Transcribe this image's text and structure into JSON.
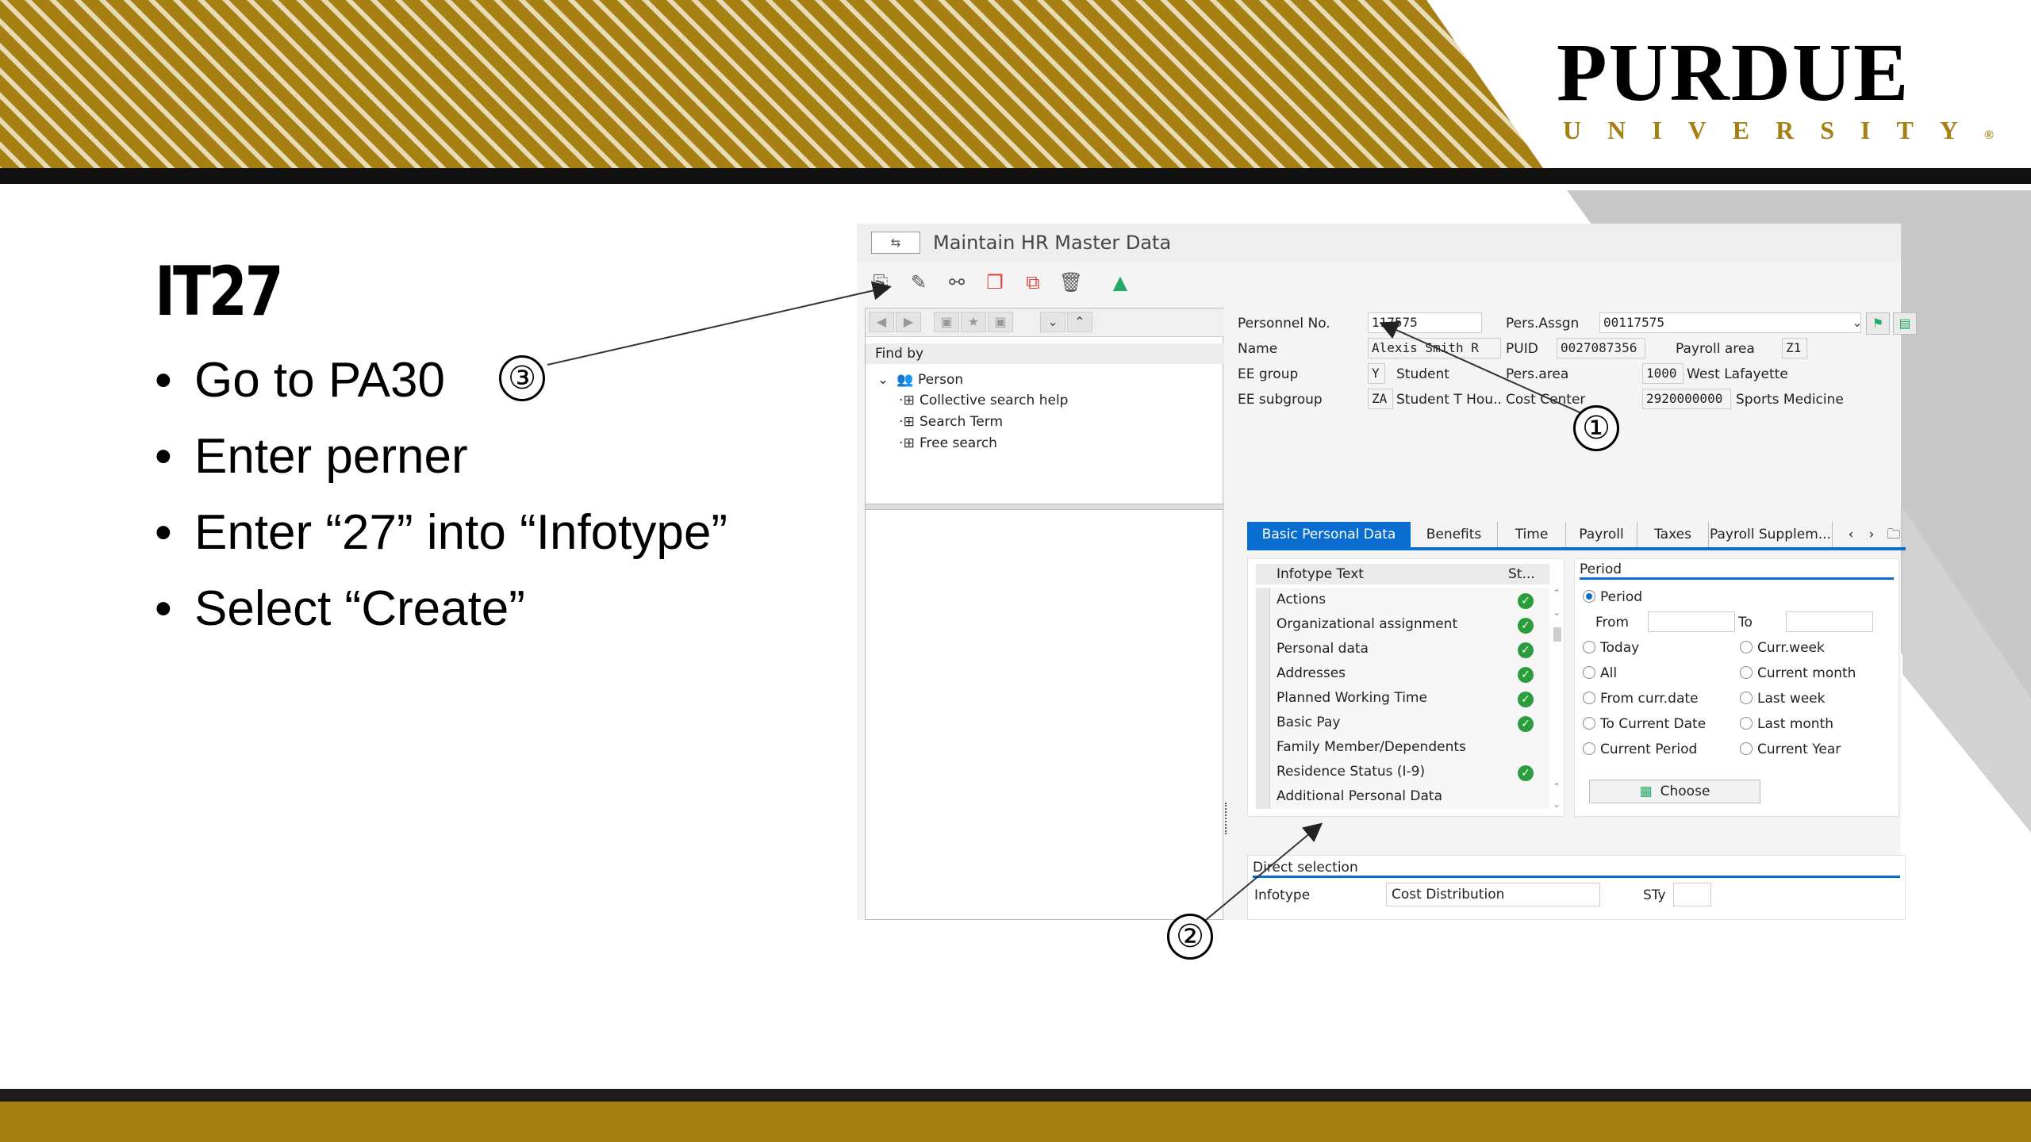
{
  "slide": {
    "title": "IT27",
    "bullets": [
      "Go to PA30",
      "Enter perner",
      "Enter “27” into “Infotype”",
      "Select “Create”"
    ],
    "callouts": [
      "③",
      "①",
      "②"
    ],
    "logo": {
      "top": "PURDUE",
      "bottom": "UNIVERSITY",
      "mark": "®"
    },
    "colors": {
      "gold": "#a68013",
      "black": "#111111",
      "gray": "#c8c8c8"
    }
  },
  "sap": {
    "window_title": "Maintain HR Master Data",
    "window_icon": "⇆",
    "toolbar_icons": [
      "create-icon",
      "change-icon",
      "display-icon",
      "copy-icon",
      "delimit-icon",
      "delete-icon",
      "overview-icon"
    ],
    "nav": {
      "find_by": "Find by",
      "person": "Person",
      "items": [
        "Collective search help",
        "Search Term",
        "Free search"
      ]
    },
    "header": {
      "personnel_no_label": "Personnel No.",
      "personnel_no": "117575",
      "pers_assgn_label": "Pers.Assgn",
      "pers_assgn": "00117575",
      "name_label": "Name",
      "name": "Alexis Smith R",
      "puid_label": "PUID",
      "puid": "0027087356",
      "payroll_area_label": "Payroll area",
      "payroll_area": "Z1",
      "ee_group_label": "EE group",
      "ee_group_code": "Y",
      "ee_group_text": "Student",
      "pers_area_label": "Pers.area",
      "pers_area_code": "1000",
      "pers_area_text": "West Lafayette",
      "ee_subgroup_label": "EE subgroup",
      "ee_subgroup_code": "ZA",
      "ee_subgroup_text": "Student T Hou..",
      "cost_center_label": "Cost Center",
      "cost_center_code": "2920000000",
      "cost_center_text": "Sports Medicine"
    },
    "tabs": [
      "Basic Personal Data",
      "Benefits",
      "Time",
      "Payroll",
      "Taxes",
      "Payroll Supplem..."
    ],
    "tab_nav": [
      "‹",
      "›",
      "🗀"
    ],
    "infotypes": {
      "col_text": "Infotype Text",
      "col_status": "St...",
      "rows": [
        {
          "text": "Actions",
          "ok": "✓"
        },
        {
          "text": "Organizational assignment",
          "ok": "✓"
        },
        {
          "text": "Personal data",
          "ok": "✓"
        },
        {
          "text": "Addresses",
          "ok": "✓"
        },
        {
          "text": "Planned Working Time",
          "ok": "✓"
        },
        {
          "text": "Basic Pay",
          "ok": "✓"
        },
        {
          "text": "Family Member/Dependents",
          "ok": ""
        },
        {
          "text": "Residence Status (I-9)",
          "ok": "✓"
        },
        {
          "text": "Additional Personal Data",
          "ok": ""
        }
      ]
    },
    "period": {
      "title": "Period",
      "period_option": "Period",
      "from_label": "From",
      "to_label": "To",
      "options_left": [
        "Today",
        "All",
        "From curr.date",
        "To Current Date",
        "Current Period"
      ],
      "options_right": [
        "Curr.week",
        "Current month",
        "Last week",
        "Last month",
        "Current Year"
      ],
      "choose": "Choose"
    },
    "direct_selection": {
      "title": "Direct selection",
      "infotype_label": "Infotype",
      "infotype_value": "Cost Distribution",
      "sty_label": "STy"
    }
  }
}
